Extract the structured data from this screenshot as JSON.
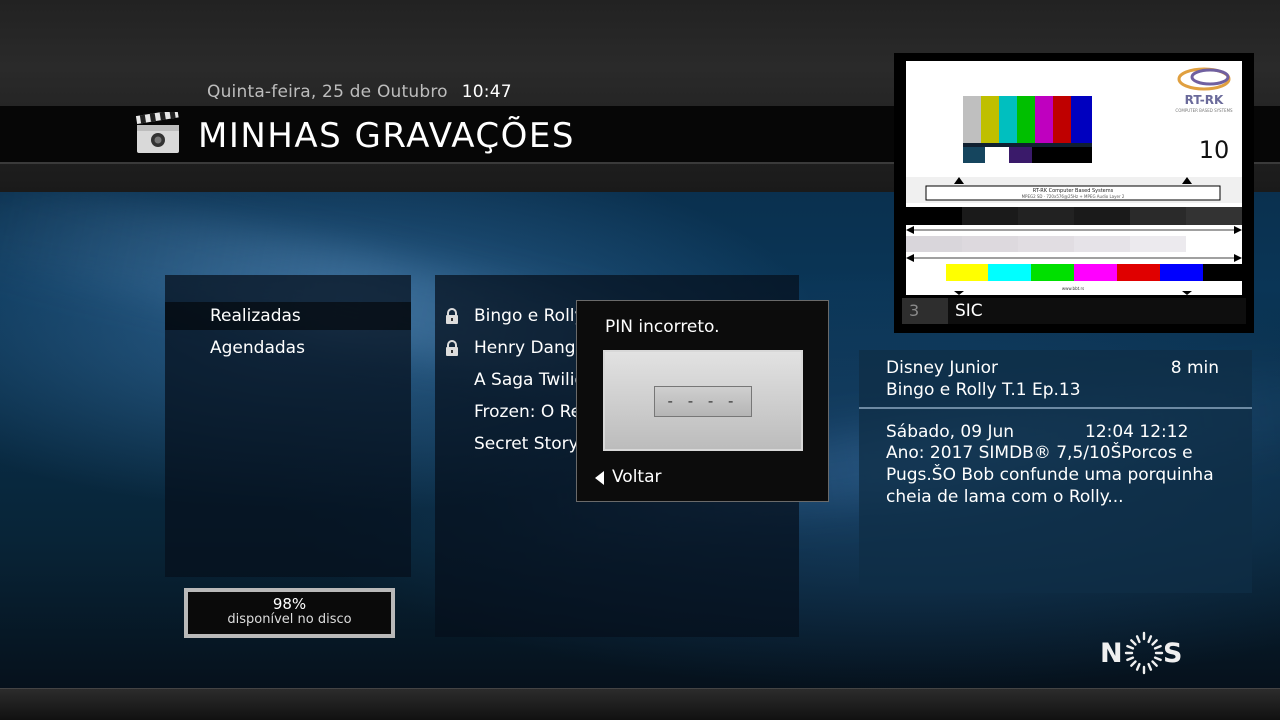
{
  "header": {
    "date": "Quinta-feira, 25 de Outubro",
    "time": "10:47",
    "title": "MINHAS GRAVAÇÕES"
  },
  "categories": [
    {
      "label": "Realizadas",
      "selected": true
    },
    {
      "label": "Agendadas",
      "selected": false
    }
  ],
  "disk": {
    "percent": "98%",
    "label": "disponível no disco"
  },
  "recordings": [
    {
      "label": "Bingo e Rolly",
      "locked": true
    },
    {
      "label": "Henry Danger",
      "locked": true
    },
    {
      "label": "A Saga Twilight",
      "locked": false
    },
    {
      "label": "Frozen: O Reino",
      "locked": false
    },
    {
      "label": "Secret Story",
      "locked": false
    }
  ],
  "pin_dialog": {
    "message": "PIN incorreto.",
    "pin_value": "- - - -",
    "back_label": "Voltar"
  },
  "preview": {
    "channel_number": "3",
    "channel_name": "SIC",
    "testcard": {
      "brand": "RT-RK",
      "brand_sub": "COMPUTER BASED SYSTEMS",
      "number": "10",
      "line1": "RT-RK Computer Based Systems",
      "line2": "MPEG2 SD · 720x576@25Hz + MPEG Audio Layer 2",
      "url": "www.bbt.rs"
    }
  },
  "info": {
    "channel": "Disney Junior",
    "duration": "8 min",
    "title": "Bingo e Rolly T.1 Ep.13",
    "date": "Sábado, 09 Jun",
    "time": "12:04 12:12",
    "description": "Ano: 2017 SIMDB® 7,5/10ŠPorcos e Pugs.ŠO Bob confunde uma porquinha cheia de lama com o Rolly..."
  },
  "brand_logo": {
    "left": "N",
    "right": "S"
  },
  "colors": {
    "accent": "#0a3556",
    "panel": "#050f1c",
    "dialog": "#0c0c0c"
  }
}
